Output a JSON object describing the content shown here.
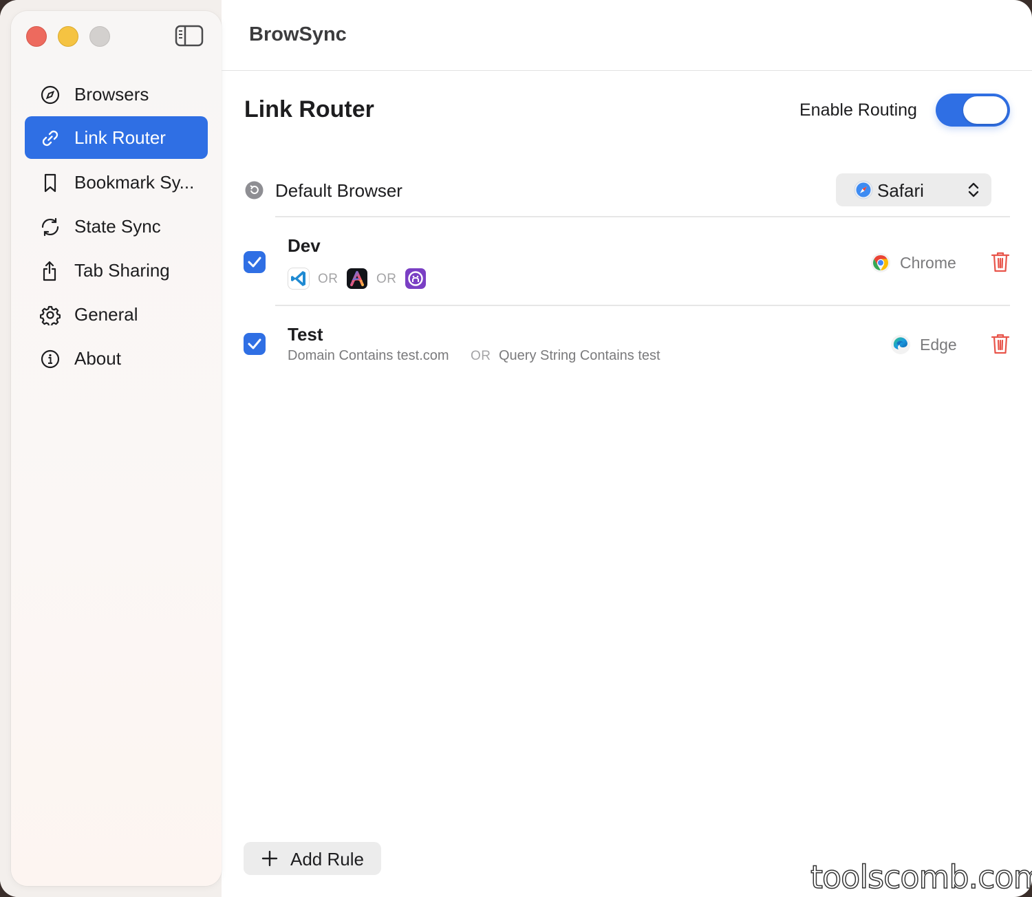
{
  "app": {
    "title": "BrowSync"
  },
  "colors": {
    "accent": "#2f6fe4",
    "close": "#ed6a5e",
    "minimize": "#f5c342",
    "zoom": "#d3d0ce",
    "trash": "#e8544a"
  },
  "sidebar": {
    "items": [
      {
        "label": "Browsers",
        "icon": "compass-icon",
        "active": false
      },
      {
        "label": "Link Router",
        "icon": "link-icon",
        "active": true
      },
      {
        "label": "Bookmark Sy...",
        "icon": "bookmark-icon",
        "active": false
      },
      {
        "label": "State Sync",
        "icon": "sync-icon",
        "active": false
      },
      {
        "label": "Tab Sharing",
        "icon": "share-icon",
        "active": false
      },
      {
        "label": "General",
        "icon": "gear-icon",
        "active": false
      },
      {
        "label": "About",
        "icon": "info-icon",
        "active": false
      }
    ]
  },
  "main": {
    "title": "Link Router",
    "enable_routing": {
      "label": "Enable Routing",
      "on": true
    },
    "default_browser": {
      "label": "Default Browser",
      "selected": "Safari",
      "icon": "safari-icon"
    },
    "rules": [
      {
        "name": "Dev",
        "enabled": true,
        "conditions": [
          {
            "type": "app",
            "icon": "vscode-icon"
          },
          {
            "type": "or",
            "text": "OR"
          },
          {
            "type": "app",
            "icon": "arc-icon"
          },
          {
            "type": "or",
            "text": "OR"
          },
          {
            "type": "app",
            "icon": "github-desktop-icon"
          }
        ],
        "browser": "Chrome",
        "browser_icon": "chrome-icon"
      },
      {
        "name": "Test",
        "enabled": true,
        "conditions": [
          {
            "type": "text",
            "text": "Domain Contains test.com"
          },
          {
            "type": "or",
            "text": "OR"
          },
          {
            "type": "text",
            "text": "Query String Contains test"
          }
        ],
        "browser": "Edge",
        "browser_icon": "edge-icon"
      }
    ],
    "add_rule_label": "Add Rule"
  },
  "watermark": "toolscomb.com"
}
